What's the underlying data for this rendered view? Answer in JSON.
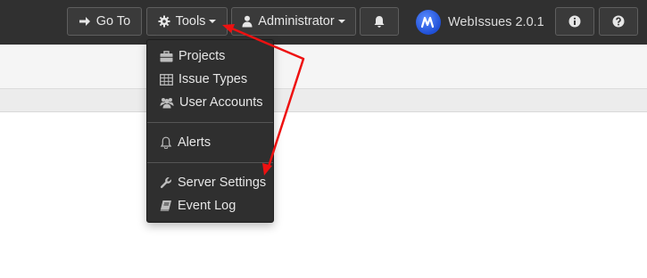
{
  "navbar": {
    "goto_label": "Go To",
    "tools_label": "Tools",
    "admin_label": "Administrator",
    "brand": "WebIssues 2.0.1",
    "alerts_icon": "bell-icon",
    "info_icon": "info-icon",
    "help_icon": "question-icon"
  },
  "tools_menu": {
    "items": [
      {
        "label": "Projects",
        "icon": "briefcase-icon"
      },
      {
        "label": "Issue Types",
        "icon": "table-icon"
      },
      {
        "label": "User Accounts",
        "icon": "users-icon"
      },
      {
        "label": "Alerts",
        "icon": "bell-outline-icon"
      },
      {
        "label": "Server Settings",
        "icon": "wrench-icon"
      },
      {
        "label": "Event Log",
        "icon": "book-icon"
      }
    ]
  },
  "annotation": {
    "arrow_color": "#ee1111"
  },
  "colors": {
    "navbar_bg": "#303030",
    "menu_bg": "#2f2f2f",
    "text": "#e6e6e6"
  }
}
